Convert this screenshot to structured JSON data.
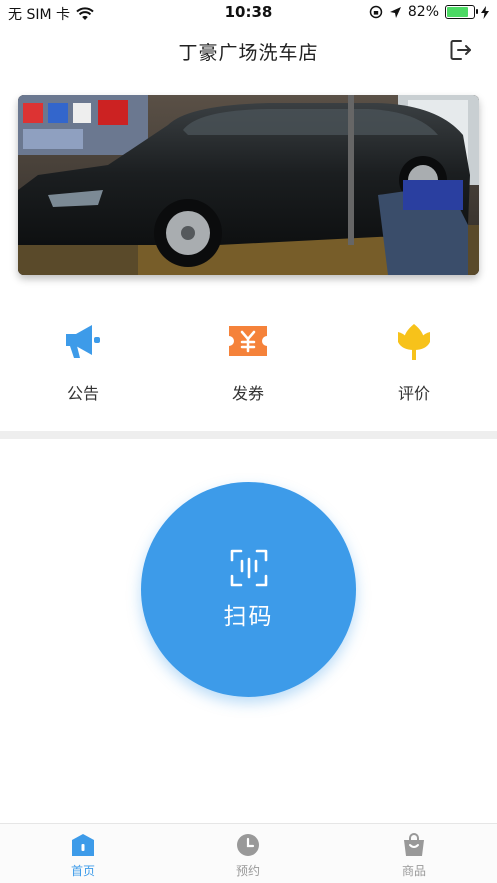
{
  "status_bar": {
    "carrier": "无 SIM 卡",
    "time": "10:38",
    "battery_percent": "82%",
    "battery_level": 0.82
  },
  "nav": {
    "title": "丁豪广场洗车店",
    "logout_icon": "logout-icon"
  },
  "banner": {
    "description_icon": "car-wash-photo"
  },
  "actions": [
    {
      "label": "公告",
      "icon": "megaphone-icon",
      "color": "#3d9be9"
    },
    {
      "label": "发券",
      "icon": "coupon-icon",
      "color": "#f5823a"
    },
    {
      "label": "评价",
      "icon": "flower-icon",
      "color": "#f7c21a"
    }
  ],
  "scan": {
    "label": "扫码",
    "icon": "scan-icon",
    "color": "#3d9be9"
  },
  "tabs": [
    {
      "label": "首页",
      "icon": "home-icon",
      "active": true
    },
    {
      "label": "预约",
      "icon": "clock-icon",
      "active": false
    },
    {
      "label": "商品",
      "icon": "bag-icon",
      "active": false
    }
  ],
  "colors": {
    "accent": "#3d9be9",
    "inactive": "#999999"
  }
}
